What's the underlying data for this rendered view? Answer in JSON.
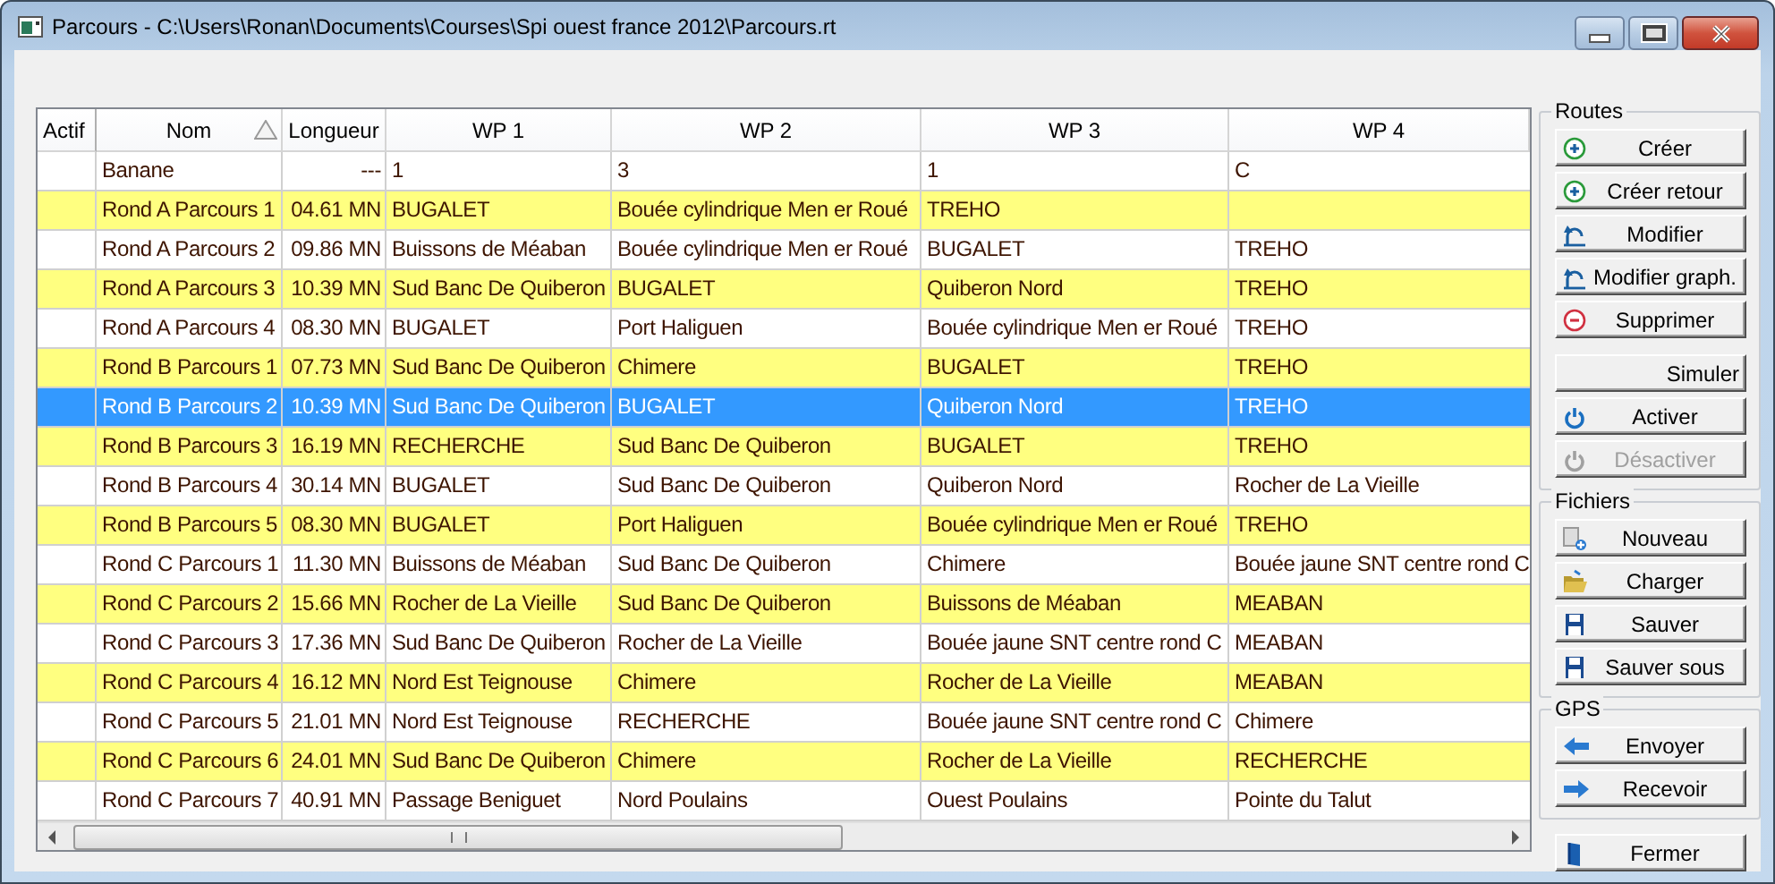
{
  "window": {
    "title": "Parcours - C:\\Users\\Ronan\\Documents\\Courses\\Spi ouest france 2012\\Parcours.rt"
  },
  "table": {
    "columns": [
      {
        "label": "Actif",
        "sorted": false
      },
      {
        "label": "Nom",
        "sorted": true
      },
      {
        "label": "Longueur",
        "sorted": false
      },
      {
        "label": "WP 1",
        "sorted": false
      },
      {
        "label": "WP 2",
        "sorted": false
      },
      {
        "label": "WP 3",
        "sorted": false
      },
      {
        "label": "WP 4",
        "sorted": false
      }
    ],
    "rows": [
      {
        "cells": [
          "",
          "Banane",
          "---",
          "1",
          "3",
          "1",
          "C"
        ],
        "highlighted": false,
        "selected": false
      },
      {
        "cells": [
          "",
          "Rond A Parcours 1",
          "04.61 MN",
          "BUGALET",
          "Bouée cylindrique Men er Roué",
          "TREHO",
          ""
        ],
        "highlighted": true,
        "selected": false
      },
      {
        "cells": [
          "",
          "Rond A Parcours 2",
          "09.86 MN",
          "Buissons de Méaban",
          "Bouée cylindrique Men er Roué",
          "BUGALET",
          "TREHO"
        ],
        "highlighted": false,
        "selected": false
      },
      {
        "cells": [
          "",
          "Rond A Parcours 3",
          "10.39 MN",
          "Sud Banc De Quiberon",
          "BUGALET",
          "Quiberon Nord",
          "TREHO"
        ],
        "highlighted": true,
        "selected": false
      },
      {
        "cells": [
          "",
          "Rond A Parcours 4",
          "08.30 MN",
          "BUGALET",
          "Port Haliguen",
          "Bouée cylindrique Men er Roué",
          "TREHO"
        ],
        "highlighted": false,
        "selected": false
      },
      {
        "cells": [
          "",
          "Rond B Parcours 1",
          "07.73 MN",
          "Sud Banc De Quiberon",
          "Chimere",
          "BUGALET",
          "TREHO"
        ],
        "highlighted": true,
        "selected": false
      },
      {
        "cells": [
          "",
          "Rond B Parcours 2",
          "10.39 MN",
          "Sud Banc De Quiberon",
          "BUGALET",
          "Quiberon Nord",
          "TREHO"
        ],
        "highlighted": true,
        "selected": true
      },
      {
        "cells": [
          "",
          "Rond B Parcours 3",
          "16.19 MN",
          "RECHERCHE",
          "Sud Banc De Quiberon",
          "BUGALET",
          "TREHO"
        ],
        "highlighted": true,
        "selected": false
      },
      {
        "cells": [
          "",
          "Rond B Parcours 4",
          "30.14 MN",
          "BUGALET",
          "Sud Banc De Quiberon",
          "Quiberon Nord",
          "Rocher de La Vieille"
        ],
        "highlighted": false,
        "selected": false
      },
      {
        "cells": [
          "",
          "Rond B Parcours 5",
          "08.30 MN",
          "BUGALET",
          "Port Haliguen",
          "Bouée cylindrique Men er Roué",
          "TREHO"
        ],
        "highlighted": true,
        "selected": false
      },
      {
        "cells": [
          "",
          "Rond C Parcours 1",
          "11.30 MN",
          "Buissons de Méaban",
          "Sud Banc De Quiberon",
          "Chimere",
          "Bouée jaune SNT centre rond C"
        ],
        "highlighted": false,
        "selected": false
      },
      {
        "cells": [
          "",
          "Rond C Parcours 2",
          "15.66 MN",
          "Rocher de La Vieille",
          "Sud Banc De Quiberon",
          "Buissons de Méaban",
          "MEABAN"
        ],
        "highlighted": true,
        "selected": false
      },
      {
        "cells": [
          "",
          "Rond C Parcours 3",
          "17.36 MN",
          "Sud Banc De Quiberon",
          "Rocher de La Vieille",
          "Bouée jaune SNT centre rond C",
          "MEABAN"
        ],
        "highlighted": false,
        "selected": false
      },
      {
        "cells": [
          "",
          "Rond C Parcours 4",
          "16.12 MN",
          "Nord Est Teignouse",
          "Chimere",
          "Rocher de La Vieille",
          "MEABAN"
        ],
        "highlighted": true,
        "selected": false
      },
      {
        "cells": [
          "",
          "Rond C Parcours 5",
          "21.01 MN",
          "Nord Est Teignouse",
          "RECHERCHE",
          "Bouée jaune SNT centre rond C",
          "Chimere"
        ],
        "highlighted": false,
        "selected": false
      },
      {
        "cells": [
          "",
          "Rond C Parcours 6",
          "24.01 MN",
          "Sud Banc De Quiberon",
          "Chimere",
          "Rocher de La Vieille",
          "RECHERCHE"
        ],
        "highlighted": true,
        "selected": false
      },
      {
        "cells": [
          "",
          "Rond C Parcours 7",
          "40.91 MN",
          "Passage Beniguet",
          "Nord Poulains",
          "Ouest Poulains",
          "Pointe du Talut"
        ],
        "highlighted": false,
        "selected": false
      }
    ]
  },
  "groups": [
    {
      "label": "Routes",
      "buttons": [
        {
          "label": "Créer",
          "kind": "add",
          "disabled": false
        },
        {
          "label": "Créer retour",
          "kind": "add",
          "disabled": false
        },
        {
          "label": "Modifier",
          "kind": "edit",
          "disabled": false
        },
        {
          "label": "Modifier graph.",
          "kind": "edit",
          "disabled": false
        },
        {
          "label": "Supprimer",
          "kind": "remove",
          "disabled": false
        },
        {
          "label": "Simuler",
          "kind": "plain",
          "disabled": false
        },
        {
          "label": "Activer",
          "kind": "power",
          "disabled": false
        },
        {
          "label": "Désactiver",
          "kind": "power",
          "disabled": true
        }
      ]
    },
    {
      "label": "Fichiers",
      "buttons": [
        {
          "label": "Nouveau",
          "kind": "new",
          "disabled": false
        },
        {
          "label": "Charger",
          "kind": "open",
          "disabled": false
        },
        {
          "label": "Sauver",
          "kind": "save",
          "disabled": false
        },
        {
          "label": "Sauver sous",
          "kind": "save",
          "disabled": false
        }
      ]
    },
    {
      "label": "GPS",
      "buttons": [
        {
          "label": "Envoyer",
          "kind": "send",
          "disabled": false
        },
        {
          "label": "Recevoir",
          "kind": "receive",
          "disabled": false
        }
      ]
    }
  ],
  "close_button": {
    "label": "Fermer",
    "kind": "close",
    "disabled": false
  }
}
